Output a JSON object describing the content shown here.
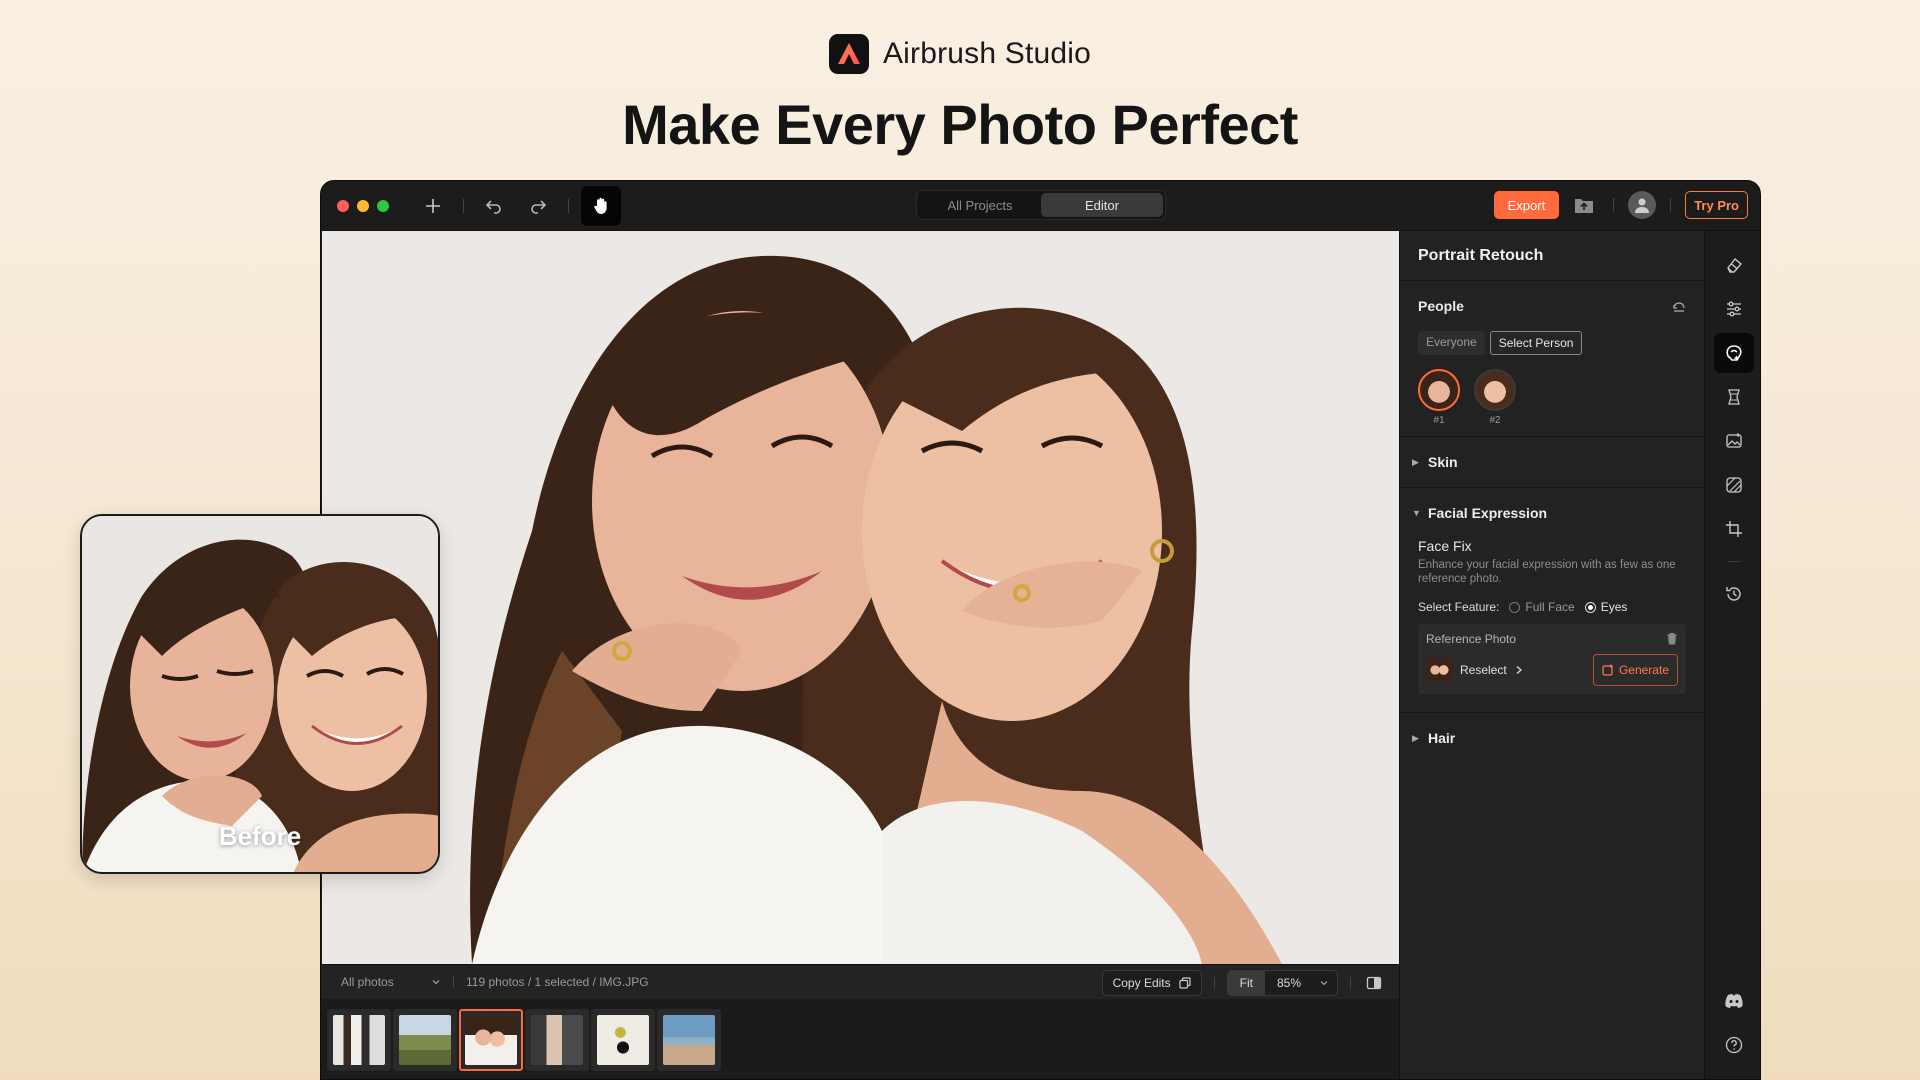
{
  "brand": {
    "name": "Airbrush Studio",
    "headline": "Make Every Photo Perfect"
  },
  "colors": {
    "accent": "#ff6a3d",
    "window_bg": "#1f1f1f",
    "panel_bg": "#222222",
    "page_bg": "#f7ebd9"
  },
  "titlebar": {
    "tabs": [
      {
        "label": "All Projects",
        "active": false
      },
      {
        "label": "Editor",
        "active": true
      }
    ],
    "tools": [
      "plus-icon",
      "undo-icon",
      "redo-icon",
      "hand-icon"
    ],
    "export_label": "Export",
    "try_pro_label": "Try Pro"
  },
  "bottombar": {
    "filter_label": "All photos",
    "status": "119 photos / 1 selected / IMG.JPG",
    "copy_edits_label": "Copy Edits",
    "fit_label": "Fit",
    "zoom": "85%"
  },
  "filmstrip": [
    {
      "name": "group-portrait",
      "selected": false
    },
    {
      "name": "landscape",
      "selected": false
    },
    {
      "name": "two-women",
      "selected": true
    },
    {
      "name": "family",
      "selected": false
    },
    {
      "name": "still-life",
      "selected": false
    },
    {
      "name": "beach",
      "selected": false
    }
  ],
  "panel": {
    "title": "Portrait Retouch",
    "people": {
      "label": "People",
      "options": [
        "Everyone",
        "Select Person"
      ],
      "selected_option": "Select Person",
      "persons": [
        {
          "label": "#1",
          "selected": true
        },
        {
          "label": "#2",
          "selected": false
        }
      ]
    },
    "skin_label": "Skin",
    "facial_expression": {
      "label": "Facial Expression",
      "face_fix_title": "Face Fix",
      "face_fix_desc": "Enhance your facial expression with as few as one reference photo.",
      "select_feature_label": "Select Feature:",
      "features": [
        {
          "label": "Full Face",
          "selected": false
        },
        {
          "label": "Eyes",
          "selected": true
        }
      ],
      "reference_label": "Reference Photo",
      "reselect_label": "Reselect",
      "generate_label": "Generate"
    },
    "hair_label": "Hair"
  },
  "rail": [
    "eraser-icon",
    "sliders-icon",
    "face-retouch-icon",
    "body-icon",
    "image-enhance-icon",
    "mask-icon",
    "crop-icon",
    "history-icon"
  ],
  "rail_bottom": [
    "discord-icon",
    "help-icon"
  ],
  "before_label": "Before"
}
